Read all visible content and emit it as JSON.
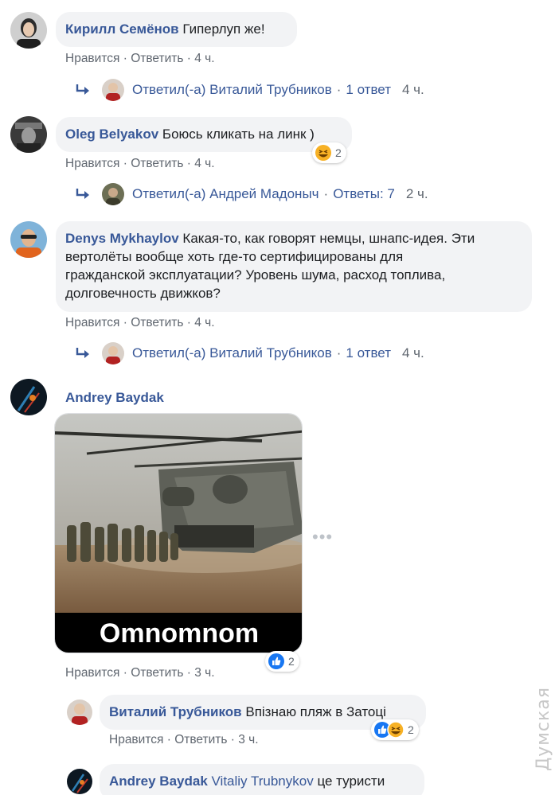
{
  "comments": [
    {
      "author": "Кирилл Семёнов",
      "text": "Гиперлуп же!",
      "like": "Нравится",
      "reply": "Ответить",
      "time": "4 ч.",
      "replies_line": {
        "prefix": "Ответил(-а) Виталий Трубников",
        "count": "1 ответ",
        "time": "4 ч."
      }
    },
    {
      "author": "Oleg Belyakov",
      "text": "Боюсь кликать на линк )",
      "reaction_count": "2",
      "like": "Нравится",
      "reply": "Ответить",
      "time": "4 ч.",
      "replies_line": {
        "prefix": "Ответил(-а) Андрей Мадоныч",
        "count": "Ответы: 7",
        "time": "2 ч."
      }
    },
    {
      "author": "Denys Mykhaylov",
      "text_lines": [
        "Какая-то, как говорят немцы, шнапс-идея. Эти",
        "вертолёты вообще хоть где-то сертифицированы для",
        "гражданской эксплуатации? Уровень шума, расход топлива,",
        "долговечность движков?"
      ],
      "like": "Нравится",
      "reply": "Ответить",
      "time": "4 ч.",
      "replies_line": {
        "prefix": "Ответил(-а) Виталий Трубников",
        "count": "1 ответ",
        "time": "4 ч."
      }
    },
    {
      "author": "Andrey Baydak",
      "image_caption": "Omnomnom",
      "reaction_count": "2",
      "like": "Нравится",
      "reply": "Ответить",
      "time": "3 ч."
    }
  ],
  "nested": [
    {
      "author": "Виталий Трубников",
      "text": "Впізнаю пляж в Затоці",
      "reaction_count": "2",
      "like": "Нравится",
      "reply": "Ответить",
      "time": "3 ч."
    },
    {
      "author": "Andrey Baydak",
      "mention": "Vitaliy Trubnykov",
      "text": "це туристи"
    }
  ],
  "more_icon": "•••",
  "watermark": "Думская",
  "colors": {
    "link": "#385898",
    "meta": "#606770",
    "bubble": "#f2f3f5",
    "like_blue": "#1877f2",
    "haha_yellow": "#f7b125"
  }
}
